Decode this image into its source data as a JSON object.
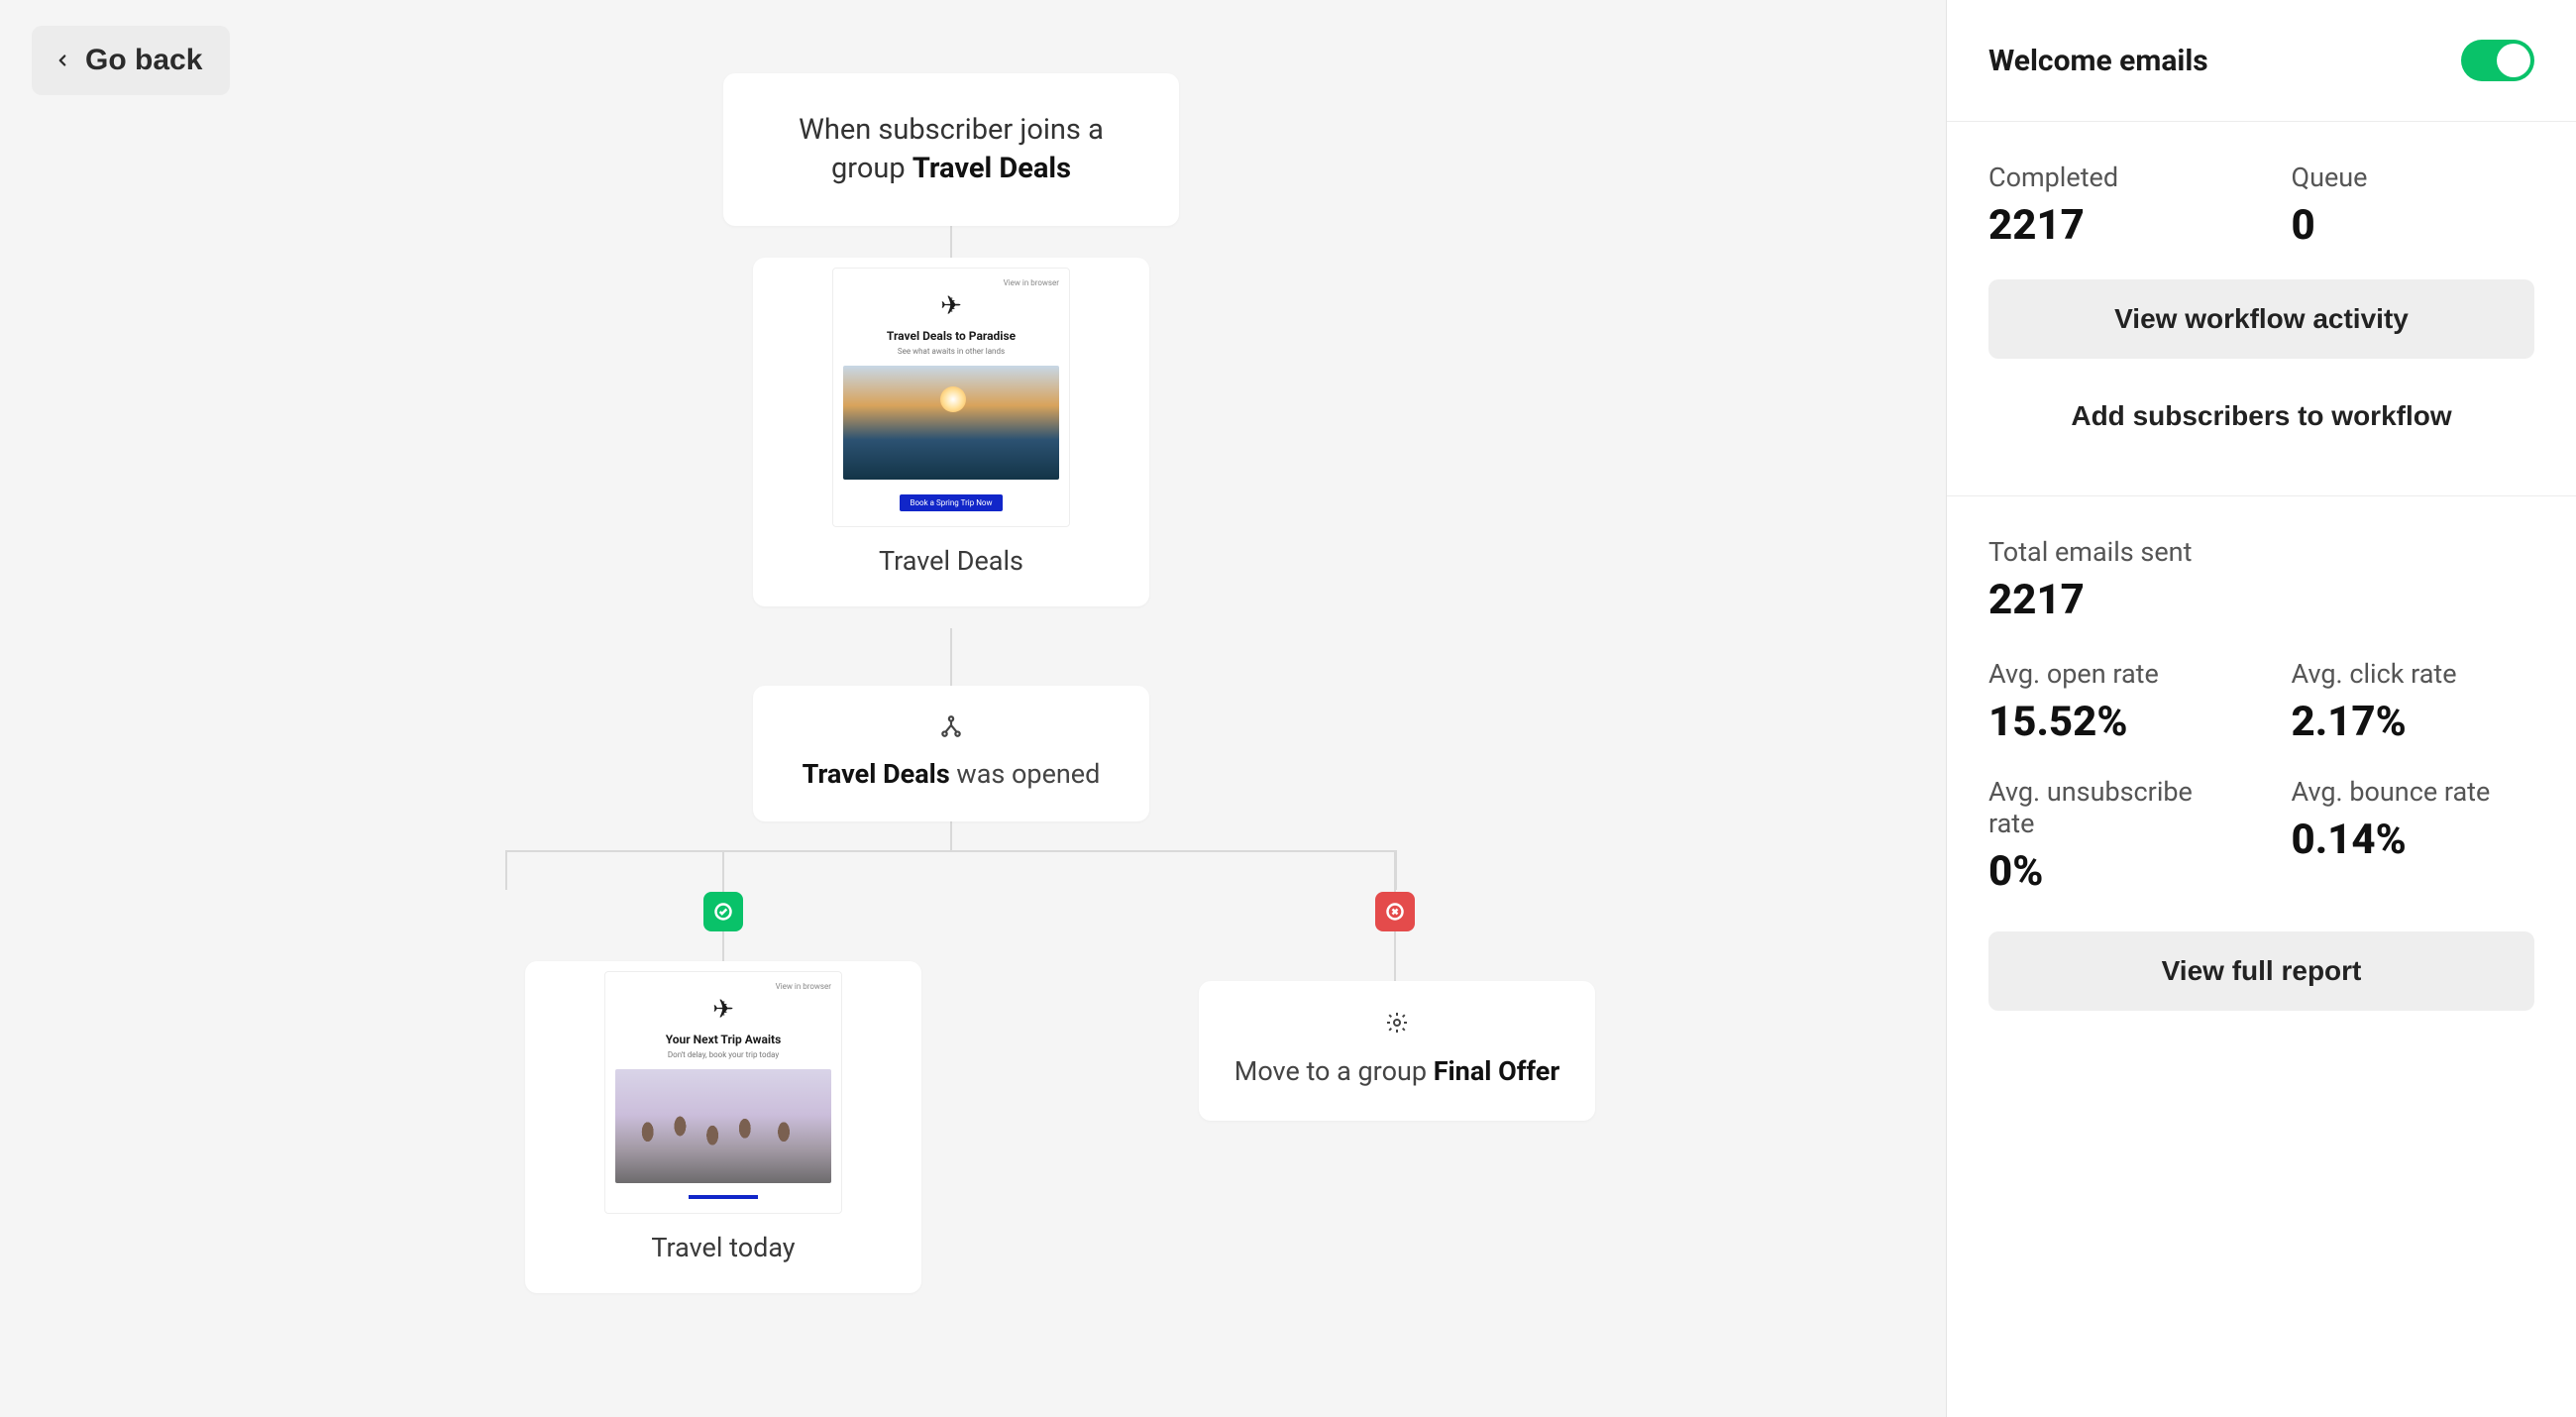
{
  "header": {
    "go_back": "Go back"
  },
  "flow": {
    "trigger": {
      "prefix": "When subscriber joins a group ",
      "group": "Travel Deals"
    },
    "email1": {
      "thumb": {
        "brand_glyph": "✈",
        "title": "Travel Deals to Paradise",
        "subtitle": "See what awaits in other lands",
        "cta": "Book a Spring Trip Now"
      },
      "caption": "Travel Deals"
    },
    "condition": {
      "subject": "Travel Deals",
      "suffix": " was opened"
    },
    "branch_yes": {
      "thumb": {
        "brand_glyph": "✈",
        "title": "Your Next Trip Awaits",
        "subtitle": "Don't delay, book your trip today"
      },
      "caption": "Travel today"
    },
    "branch_no": {
      "prefix": "Move to a group ",
      "group": "Final Offer"
    }
  },
  "sidebar": {
    "title": "Welcome emails",
    "toggle_on": true,
    "completed": {
      "label": "Completed",
      "value": "2217"
    },
    "queue": {
      "label": "Queue",
      "value": "0"
    },
    "btn_activity": "View workflow activity",
    "btn_add": "Add subscribers to workflow",
    "total_sent": {
      "label": "Total emails sent",
      "value": "2217"
    },
    "open_rate": {
      "label": "Avg. open rate",
      "value": "15.52%"
    },
    "click_rate": {
      "label": "Avg. click rate",
      "value": "2.17%"
    },
    "unsub_rate": {
      "label": "Avg. unsubscribe rate",
      "value": "0%"
    },
    "bounce_rate": {
      "label": "Avg. bounce rate",
      "value": "0.14%"
    },
    "btn_report": "View full report"
  }
}
